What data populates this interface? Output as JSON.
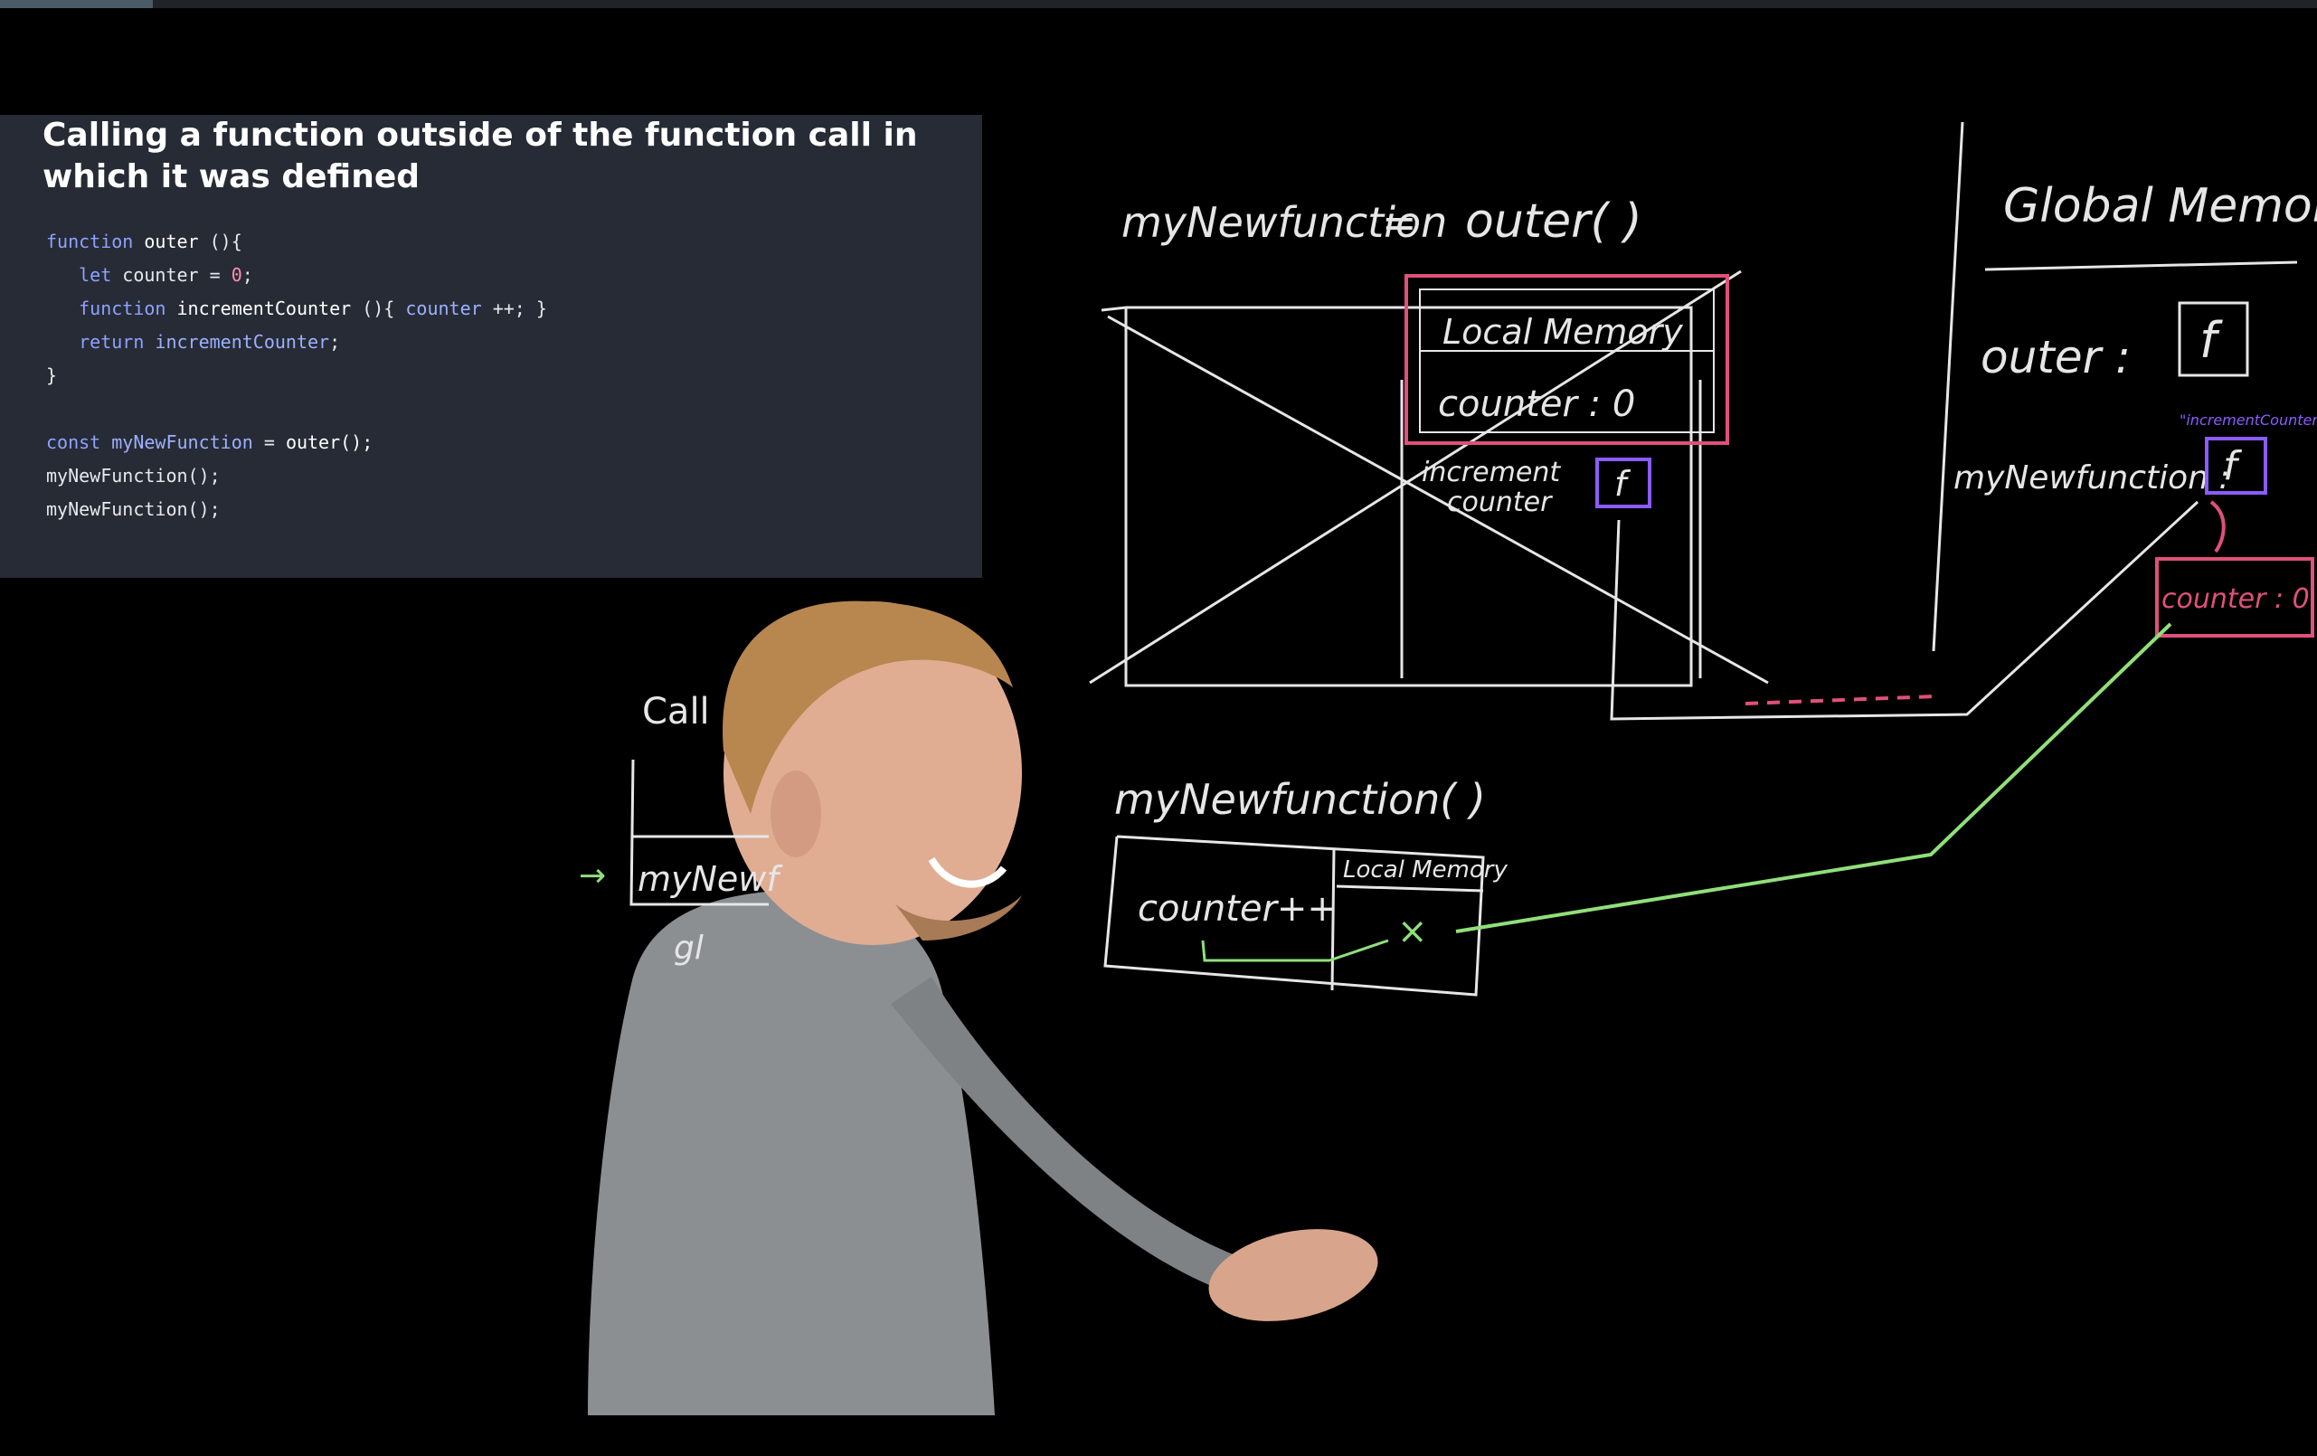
{
  "player": {
    "progress_percent": 6.6
  },
  "slide": {
    "title_line1": "Calling a function outside of the function call in",
    "title_line2": "which it was defined",
    "code": {
      "l1_kw": "function",
      "l1_name": "outer",
      "l1_rest": " (){",
      "l2_kw": "let",
      "l2_var": "counter",
      "l2_eq": " = ",
      "l2_num": "0",
      "l2_end": ";",
      "l3_kw": "function",
      "l3_name": "incrementCounter",
      "l3_mid": " (){ ",
      "l3_var": "counter",
      "l3_op": " ++; }",
      "l4_kw": "return",
      "l4_name": "incrementCounter",
      "l4_end": ";",
      "l5": "}",
      "l7_kw": "const",
      "l7_var": "myNewFunction",
      "l7_eq": " = ",
      "l7_call": "outer();",
      "l8": "myNewFunction();",
      "l9": "myNewFunction();"
    }
  },
  "board": {
    "assign_label": "myNewfunction",
    "assign_eq": "=",
    "assign_call": "outer( )",
    "local_memory_top": "Local Memory",
    "counter_entry": "counter : 0",
    "increment_label_1": "increment",
    "increment_label_2": "counter",
    "f_symbol": "f",
    "global_memory": "Global Memory",
    "global_outer": "outer :",
    "global_mynewfunction": "myNewfunction :",
    "increment_note": "\"incrementCounter\"",
    "backpack_counter": "counter : 0",
    "call_stack": "Call",
    "call_stack_frame": "myNewf",
    "call_stack_global": "gl",
    "call_expression": "myNewfunction( )",
    "counter_pp": "counter++",
    "local_memory_small": "Local Memory",
    "x_mark": "×",
    "arrow_mark": "→"
  },
  "colors": {
    "panel_bg": "#262b35",
    "keyword": "#8ea2ff",
    "number": "#ff8fb1",
    "chalk": "#e6e6e6",
    "pink": "#e0507a",
    "purple": "#8a5cff",
    "green": "#8fe07a"
  }
}
